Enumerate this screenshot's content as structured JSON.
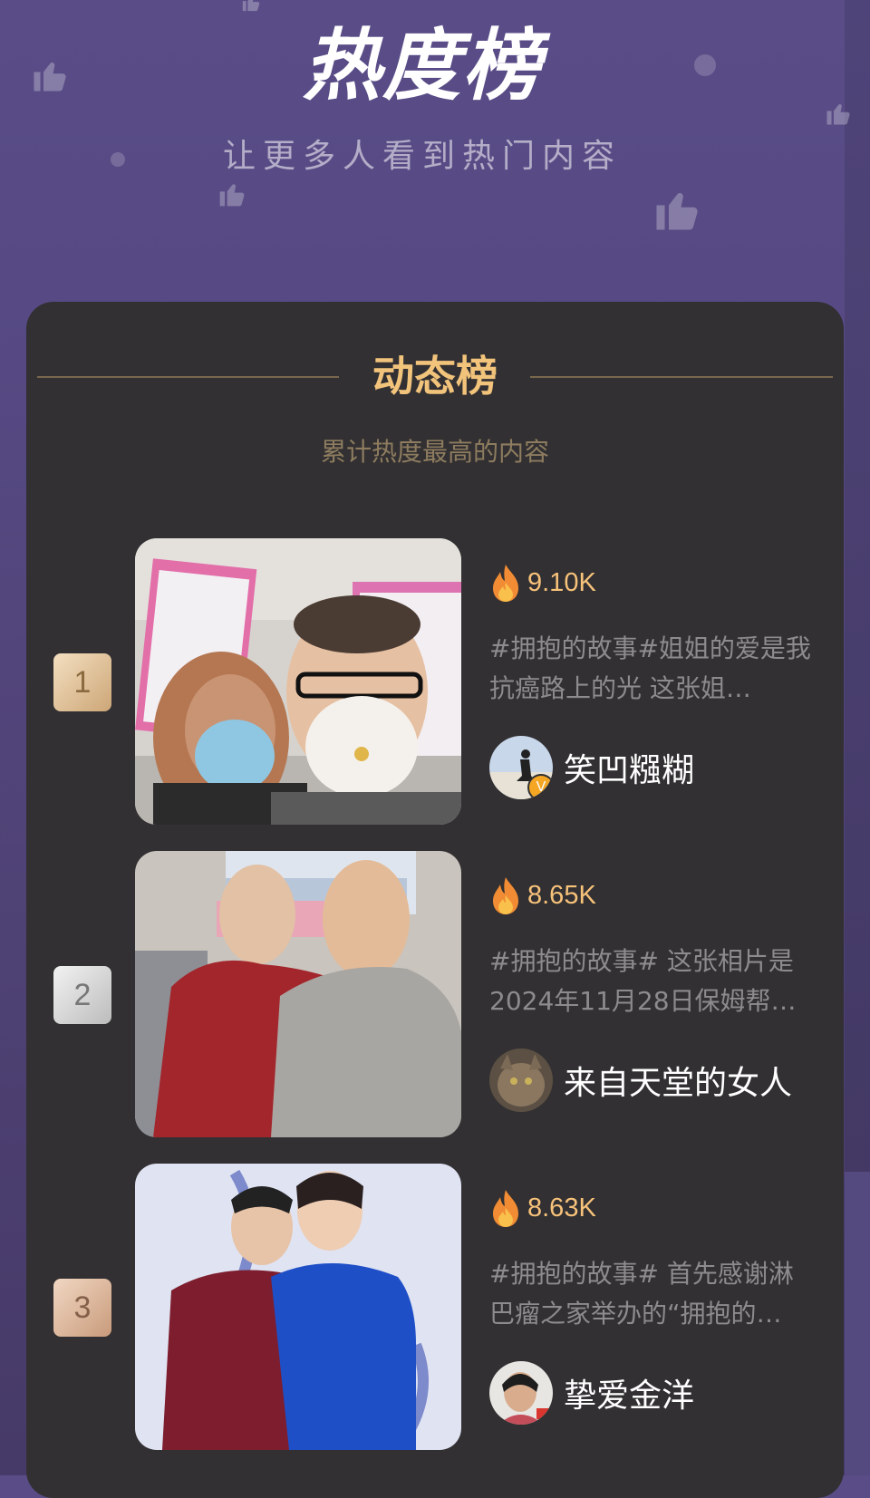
{
  "header": {
    "title": "热度榜",
    "subtitle": "让更多人看到热门内容"
  },
  "section": {
    "title": "动态榜",
    "subtitle": "累计热度最高的内容"
  },
  "items": [
    {
      "rank": "1",
      "hot": "9.10K",
      "desc": "#拥抱的故事#姐姐的爱是我抗癌路上的光 这张姐…",
      "author": "笑凹糨糊",
      "verified": true
    },
    {
      "rank": "2",
      "hot": "8.65K",
      "desc": "#拥抱的故事# 这张相片是2024年11月28日保姆帮…",
      "author": "来自天堂的女人",
      "verified": false
    },
    {
      "rank": "3",
      "hot": "8.63K",
      "desc": "#拥抱的故事# 首先感谢淋巴瘤之家举办的“拥抱的…",
      "author": "挚爱金洋",
      "verified": false
    }
  ],
  "icons": {
    "fire": "fire-icon",
    "thumb_up": "thumbs-up-icon",
    "verified": "verified-badge-icon"
  },
  "colors": {
    "hot_value": "#f7c27a",
    "section_title": "#f2c37b",
    "card_bg": "#323032"
  }
}
